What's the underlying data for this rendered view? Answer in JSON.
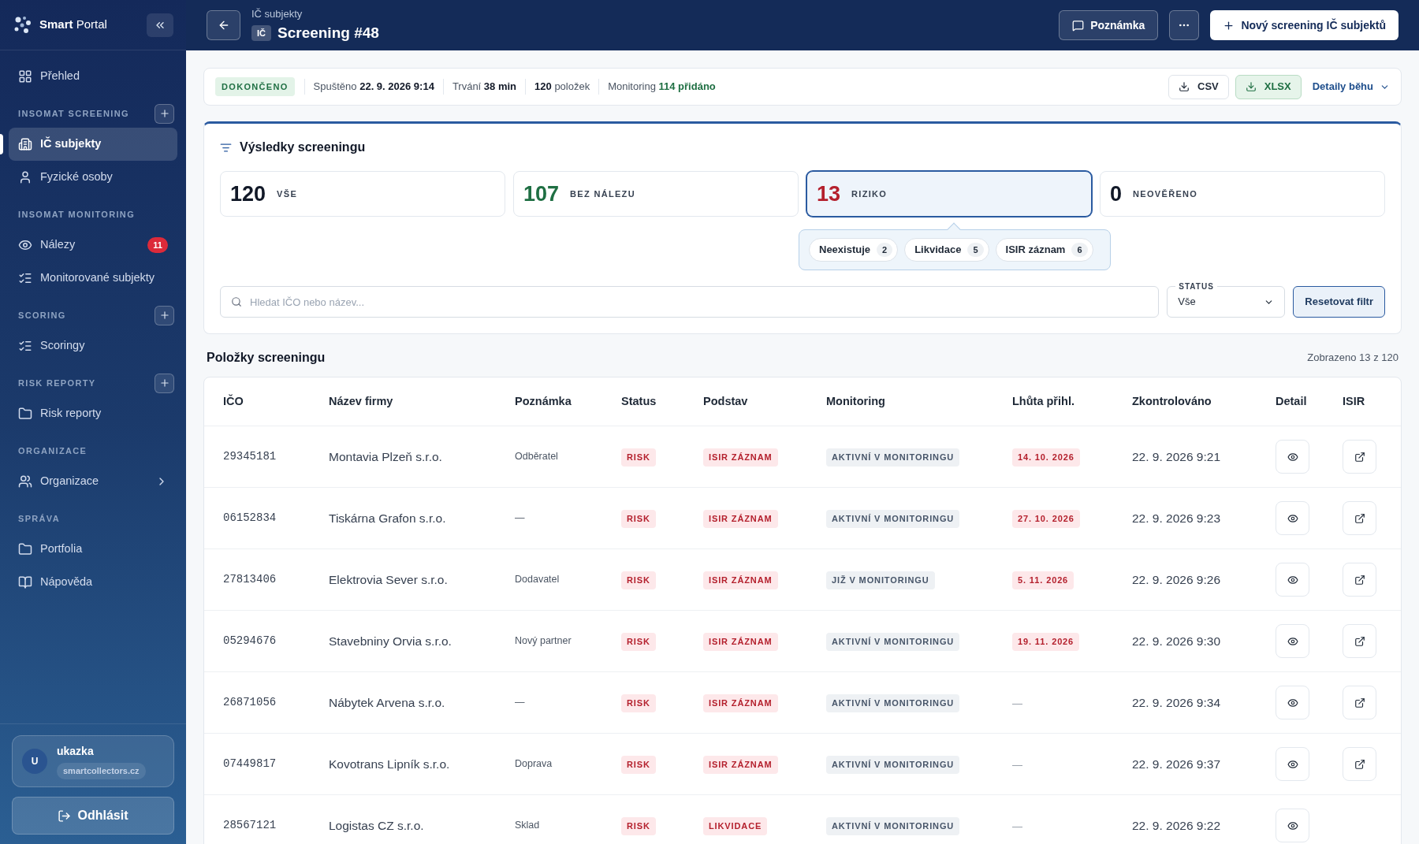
{
  "sidebar": {
    "brand": {
      "bold": "Smart",
      "rest": "Portal"
    },
    "groups": [
      {
        "items": [
          {
            "label": "Přehled",
            "selected": false
          }
        ]
      },
      {
        "title": "INSOMAT SCREENING",
        "add": true,
        "items": [
          {
            "label": "IČ subjekty",
            "selected": true
          },
          {
            "label": "Fyzické osoby",
            "selected": false
          }
        ]
      },
      {
        "title": "INSOMAT MONITORING",
        "add": false,
        "items": [
          {
            "label": "Nálezy",
            "selected": false,
            "badge": "11"
          },
          {
            "label": "Monitorované subjekty",
            "selected": false
          }
        ]
      },
      {
        "title": "SCORING",
        "add": true,
        "items": [
          {
            "label": "Scoringy",
            "selected": false
          }
        ]
      },
      {
        "title": "RISK REPORTY",
        "add": true,
        "items": [
          {
            "label": "Risk reporty",
            "selected": false
          }
        ]
      },
      {
        "title": "ORGANIZACE",
        "add": false,
        "items": [
          {
            "label": "Organizace",
            "selected": false,
            "expandable": true
          }
        ]
      },
      {
        "title": "SPRÁVA",
        "add": false,
        "items": [
          {
            "label": "Portfolia",
            "selected": false
          },
          {
            "label": "Nápověda",
            "selected": false
          }
        ]
      }
    ],
    "user": {
      "initial": "U",
      "name": "ukazka",
      "domain": "smartcollectors.cz"
    },
    "logout": "Odhlásit"
  },
  "header": {
    "breadcrumb": "IČ subjekty",
    "tag": "IČ",
    "title": "Screening #48",
    "note_button": "Poznámka",
    "new_button": "Nový screening IČ subjektů"
  },
  "run": {
    "status": "DOKONČENO",
    "facts": [
      {
        "kind": "label_first",
        "label": "Spuštěno",
        "value": "22. 9. 2026 9:14",
        "color": "#111827"
      },
      {
        "kind": "label_first",
        "label": "Trvání",
        "value": "38 min",
        "color": "#111827"
      },
      {
        "kind": "value_first",
        "label": "položek",
        "value": "120",
        "color": "#111827"
      },
      {
        "kind": "label_first",
        "label": "Monitoring",
        "value": "114 přidáno",
        "color": "#1f6f43"
      }
    ],
    "exports": [
      {
        "label": "CSV",
        "kind": "plain"
      },
      {
        "label": "XLSX",
        "kind": "highlight"
      }
    ],
    "details": "Detaily běhu"
  },
  "results": {
    "title": "Výsledky screeningu",
    "cards": [
      {
        "count": "120",
        "label": "VŠE",
        "selected": false,
        "color": "#111827"
      },
      {
        "count": "107",
        "label": "BEZ NÁLEZU",
        "selected": false,
        "color": "#1f6f43"
      },
      {
        "count": "13",
        "label": "RIZIKO",
        "selected": true,
        "color": "#b4202d"
      },
      {
        "count": "0",
        "label": "NEOVĚŘENO",
        "selected": false,
        "color": "#111827"
      }
    ],
    "chips": [
      {
        "label": "Neexistuje",
        "count": "2"
      },
      {
        "label": "Likvidace",
        "count": "5"
      },
      {
        "label": "ISIR záznam",
        "count": "6"
      }
    ],
    "search": {
      "placeholder": "Hledat IČO nebo název..."
    },
    "status_select": {
      "label": "STATUS",
      "value": "Vše"
    },
    "reset": "Resetovat filtr"
  },
  "table": {
    "title": "Položky screeningu",
    "summary": "Zobrazeno 13 z 120",
    "columns": [
      "IČO",
      "Název firmy",
      "Poznámka",
      "Status",
      "Podstav",
      "Monitoring",
      "Lhůta přihl.",
      "Zkontrolováno",
      "Detail",
      "ISIR"
    ],
    "rows": [
      {
        "ico": "29345181",
        "name": "Montavia Plzeň s.r.o.",
        "note": "Odběratel",
        "status": "RISK",
        "basis": "ISIR ZÁZNAM",
        "monitoring": "AKTIVNÍ V MONITORINGU",
        "deadline": {
          "kind": "date",
          "text": "14. 10. 2026"
        },
        "checked": "22. 9. 2026 9:21",
        "isir": true
      },
      {
        "ico": "06152834",
        "name": "Tiskárna Grafon s.r.o.",
        "note": "—",
        "status": "RISK",
        "basis": "ISIR ZÁZNAM",
        "monitoring": "AKTIVNÍ V MONITORINGU",
        "deadline": {
          "kind": "date",
          "text": "27. 10. 2026"
        },
        "checked": "22. 9. 2026 9:23",
        "isir": true
      },
      {
        "ico": "27813406",
        "name": "Elektrovia Sever s.r.o.",
        "note": "Dodavatel",
        "status": "RISK",
        "basis": "ISIR ZÁZNAM",
        "monitoring": "JIŽ V MONITORINGU",
        "deadline": {
          "kind": "date",
          "text": "5. 11. 2026"
        },
        "checked": "22. 9. 2026 9:26",
        "isir": true
      },
      {
        "ico": "05294676",
        "name": "Stavebniny Orvia s.r.o.",
        "note": "Nový partner",
        "status": "RISK",
        "basis": "ISIR ZÁZNAM",
        "monitoring": "AKTIVNÍ V MONITORINGU",
        "deadline": {
          "kind": "date",
          "text": "19. 11. 2026"
        },
        "checked": "22. 9. 2026 9:30",
        "isir": true
      },
      {
        "ico": "26871056",
        "name": "Nábytek Arvena s.r.o.",
        "note": "—",
        "status": "RISK",
        "basis": "ISIR ZÁZNAM",
        "monitoring": "AKTIVNÍ V MONITORINGU",
        "deadline": {
          "kind": "none",
          "text": "—"
        },
        "checked": "22. 9. 2026 9:34",
        "isir": true
      },
      {
        "ico": "07449817",
        "name": "Kovotrans Lipník s.r.o.",
        "note": "Doprava",
        "status": "RISK",
        "basis": "ISIR ZÁZNAM",
        "monitoring": "AKTIVNÍ V MONITORINGU",
        "deadline": {
          "kind": "none",
          "text": "—"
        },
        "checked": "22. 9. 2026 9:37",
        "isir": true
      },
      {
        "ico": "28567121",
        "name": "Logistas CZ s.r.o.",
        "note": "Sklad",
        "status": "RISK",
        "basis": "LIKVIDACE",
        "monitoring": "AKTIVNÍ V MONITORINGU",
        "deadline": {
          "kind": "none",
          "text": "—"
        },
        "checked": "22. 9. 2026 9:22",
        "isir": false
      }
    ]
  }
}
